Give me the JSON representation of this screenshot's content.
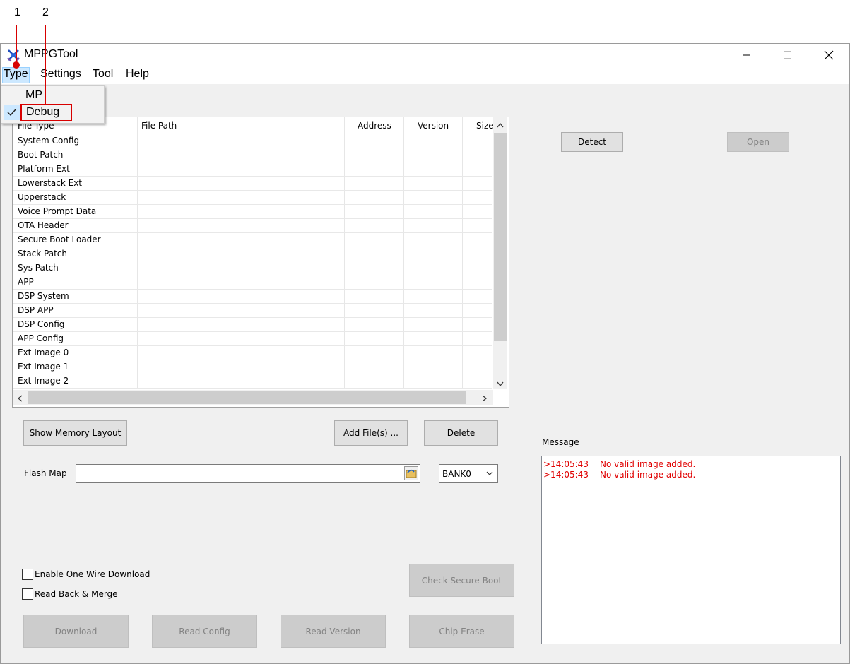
{
  "callouts": {
    "one": "1",
    "two": "2"
  },
  "window": {
    "title": "MPPGTool",
    "minimize": "—",
    "maximize": "☐",
    "close": "✕"
  },
  "menubar": {
    "type": "Type",
    "settings": "Settings",
    "tool": "Tool",
    "help": "Help"
  },
  "type_menu": {
    "mp": "MP",
    "debug": "Debug",
    "debug_checked": true
  },
  "table": {
    "columns": [
      "File Type",
      "File Path",
      "Address",
      "Version",
      "Size"
    ],
    "rows": [
      "System Config",
      "Boot Patch",
      "Platform Ext",
      "Lowerstack Ext",
      "Upperstack",
      "Voice Prompt Data",
      "OTA Header",
      "Secure Boot Loader",
      "Stack Patch",
      "Sys Patch",
      "APP",
      "DSP System",
      "DSP APP",
      "DSP Config",
      "APP Config",
      "Ext Image 0",
      "Ext Image 1",
      "Ext Image 2"
    ]
  },
  "buttons": {
    "detect": "Detect",
    "open": "Open",
    "show_memory_layout": "Show Memory Layout",
    "add_files": "Add File(s) ...",
    "delete": "Delete",
    "check_secure_boot": "Check Secure Boot",
    "download": "Download",
    "read_config": "Read Config",
    "read_version": "Read Version",
    "chip_erase": "Chip Erase"
  },
  "flash_map": {
    "label": "Flash Map",
    "value": "",
    "bank": "BANK0"
  },
  "options": {
    "one_wire": "Enable One Wire Download",
    "read_back": "Read Back & Merge"
  },
  "message": {
    "label": "Message",
    "lines": [
      {
        "time": ">14:05:43",
        "text": "No valid image added."
      },
      {
        "time": ">14:05:43",
        "text": "No valid image added."
      }
    ]
  },
  "colors": {
    "callout_red": "#d80000",
    "message_red": "#e00000"
  }
}
